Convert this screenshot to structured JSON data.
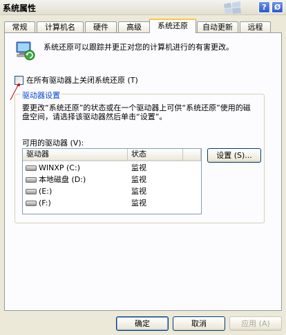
{
  "window": {
    "title": "系统属性",
    "help_glyph": "?",
    "close_glyph": "Ø"
  },
  "tabs": [
    {
      "label": "常规",
      "active": false
    },
    {
      "label": "计算机名",
      "active": false
    },
    {
      "label": "硬件",
      "active": false
    },
    {
      "label": "高级",
      "active": false
    },
    {
      "label": "系统还原",
      "active": true
    },
    {
      "label": "自动更新",
      "active": false
    },
    {
      "label": "远程",
      "active": false
    }
  ],
  "intro_text": "系统还原可以跟踪并更正对您的计算机进行的有害更改。",
  "disable_checkbox": {
    "label": "在所有驱动器上关闭系统还原 (T)",
    "checked": false
  },
  "group": {
    "legend": "驱动器设置",
    "description": "要更改“系统还原”的状态或在一个驱动器上可供“系统还原”使用的磁盘空间，请选择该驱动器然后单击“设置”。",
    "available_label": "可用的驱动器 (V):",
    "columns": [
      "驱动器",
      "状态"
    ],
    "drives": [
      {
        "name": "WINXP (C:)",
        "status": "监视"
      },
      {
        "name": "本地磁盘 (D:)",
        "status": "监视"
      },
      {
        "name": "(E:)",
        "status": "监视"
      },
      {
        "name": "(F:)",
        "status": "监视"
      }
    ],
    "settings_button": "设置 (S)..."
  },
  "buttons": {
    "ok": "确定",
    "cancel": "取消",
    "apply": "应用 (A)"
  },
  "colors": {
    "accent_blue": "#0046d5",
    "active_tab_highlight": "#ffc83c",
    "arrow_red": "#cc0000"
  }
}
